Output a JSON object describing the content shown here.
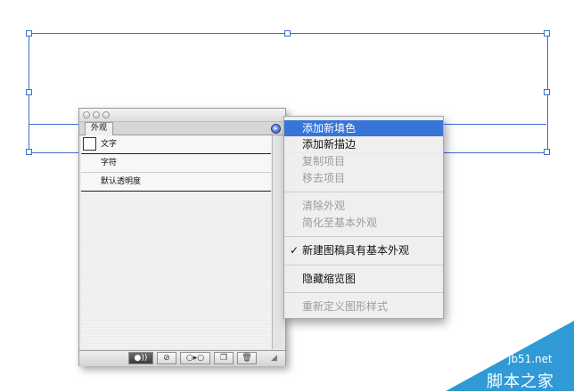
{
  "panel": {
    "tab_label": "外观",
    "menu_button_icon": "flyout-arrow-icon",
    "items": [
      {
        "label": "文字"
      },
      {
        "label": "字符"
      },
      {
        "label": "默认透明度"
      }
    ],
    "bottom_icons": [
      "appearance-toggle-icon",
      "clear-icon",
      "reduce-basic-icon",
      "duplicate-icon",
      "trash-icon"
    ]
  },
  "menu": {
    "items": [
      {
        "label": "添加新填色",
        "state": "highlighted"
      },
      {
        "label": "添加新描边",
        "state": "enabled"
      },
      {
        "label": "复制项目",
        "state": "disabled"
      },
      {
        "label": "移去项目",
        "state": "disabled"
      },
      {
        "label": "清除外观",
        "state": "disabled"
      },
      {
        "label": "简化至基本外观",
        "state": "disabled"
      },
      {
        "label": "新建图稿具有基本外观",
        "state": "checked"
      },
      {
        "label": "隐藏缩览图",
        "state": "enabled"
      },
      {
        "label": "重新定义图形样式",
        "state": "disabled"
      }
    ],
    "check_glyph": "✓"
  },
  "colors": {
    "highlight": "#3875d7",
    "selection": "#3a6fd0",
    "watermark": "#2f9ad6"
  },
  "watermark": {
    "url": "jb51.net",
    "name": "脚本之家"
  }
}
